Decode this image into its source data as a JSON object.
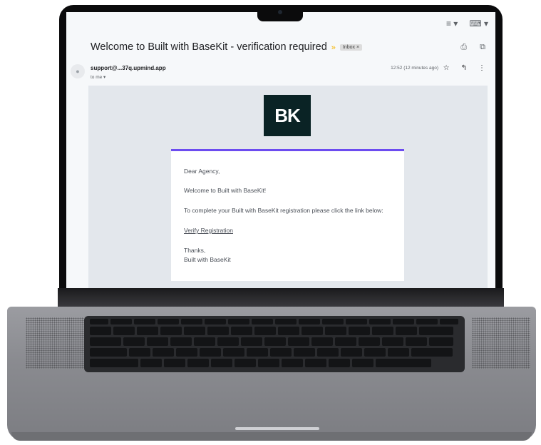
{
  "email": {
    "subject": "Welcome to Built with BaseKit - verification required",
    "important_marker": "»",
    "label": "Inbox ×",
    "sender": "support@...37q.upmind.app",
    "recipient": "to me ▾",
    "timestamp": "12:52 (12 minutes ago)",
    "toolbar_icons": [
      "list-density-icon",
      "keyboard-icon"
    ],
    "header_icons": [
      "print-icon",
      "open-new-window-icon"
    ],
    "row_icons": [
      "star-icon",
      "reply-icon",
      "more-vert-icon"
    ]
  },
  "message": {
    "logo_text": "BK",
    "greeting": "Dear Agency,",
    "welcome": "Welcome to Built with BaseKit!",
    "instruction": "To complete your Built with BaseKit registration please click the link below:",
    "link_label": "Verify Registration",
    "signoff": "Thanks,",
    "signature": "Built with BaseKit"
  },
  "colors": {
    "accent_bar": "#6c4cf0",
    "logo_bg": "#0a2325",
    "link": "#1f5fd6",
    "important": "#f6b500"
  }
}
